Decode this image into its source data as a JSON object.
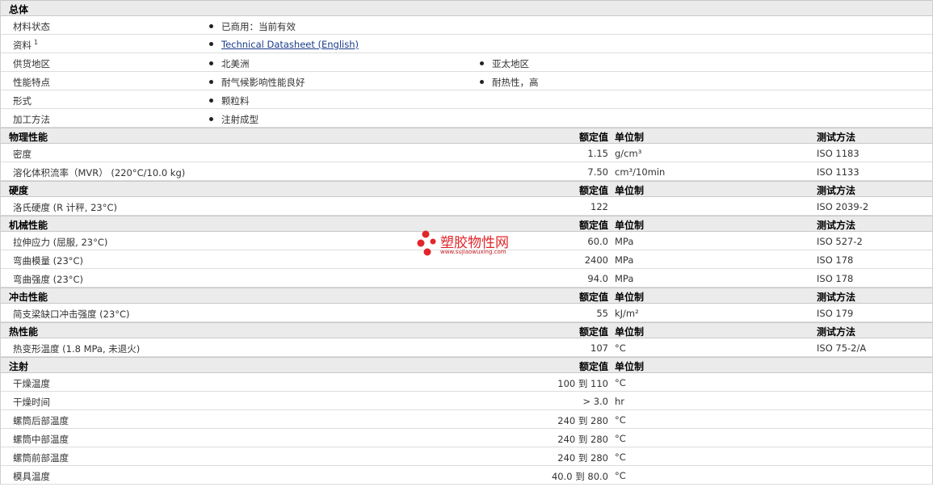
{
  "general": {
    "title": "总体",
    "rows": [
      {
        "label": "材料状态",
        "b1": "已商用：当前有效"
      },
      {
        "label": "资料",
        "sup": "1",
        "b1": "Technical Datasheet (English)"
      },
      {
        "label": "供货地区",
        "b1": "北美洲",
        "b2": "亚太地区"
      },
      {
        "label": "性能特点",
        "b1": "耐气候影响性能良好",
        "b2": "耐热性，高"
      },
      {
        "label": "形式",
        "b1": "颗粒料"
      },
      {
        "label": "加工方法",
        "b1": "注射成型"
      }
    ]
  },
  "headers": {
    "value": "额定值",
    "unit": "单位制",
    "method": "测试方法"
  },
  "physical": {
    "title": "物理性能",
    "rows": [
      {
        "label": "密度",
        "value": "1.15",
        "unit": "g/cm³",
        "method": "ISO 1183"
      },
      {
        "label": "溶化体积流率（MVR） (220°C/10.0 kg)",
        "value": "7.50",
        "unit": "cm³/10min",
        "method": "ISO 1133"
      }
    ]
  },
  "hardness": {
    "title": "硬度",
    "rows": [
      {
        "label": "洛氏硬度 (R 计秤, 23°C)",
        "value": "122",
        "unit": "",
        "method": "ISO 2039-2"
      }
    ]
  },
  "mechanical": {
    "title": "机械性能",
    "rows": [
      {
        "label": "拉伸应力 (屈服, 23°C)",
        "value": "60.0",
        "unit": "MPa",
        "method": "ISO 527-2"
      },
      {
        "label": "弯曲模量 (23°C)",
        "value": "2400",
        "unit": "MPa",
        "method": "ISO 178"
      },
      {
        "label": "弯曲强度 (23°C)",
        "value": "94.0",
        "unit": "MPa",
        "method": "ISO 178"
      }
    ]
  },
  "impact": {
    "title": "冲击性能",
    "rows": [
      {
        "label": "简支梁缺口冲击强度 (23°C)",
        "value": "55",
        "unit": "kJ/m²",
        "method": "ISO 179"
      }
    ]
  },
  "thermal": {
    "title": "热性能",
    "rows": [
      {
        "label": "热变形温度 (1.8 MPa, 未退火)",
        "value": "107",
        "unit": "°C",
        "method": "ISO 75-2/A"
      }
    ]
  },
  "injection": {
    "title": "注射",
    "rows": [
      {
        "label": "干燥温度",
        "value": "100 到  110",
        "unit": "°C"
      },
      {
        "label": "干燥时间",
        "value": "> 3.0",
        "unit": "hr"
      },
      {
        "label": "螺筒后部温度",
        "value": "240 到  280",
        "unit": "°C"
      },
      {
        "label": "螺筒中部温度",
        "value": "240 到  280",
        "unit": "°C"
      },
      {
        "label": "螺筒前部温度",
        "value": "240 到  280",
        "unit": "°C"
      },
      {
        "label": "模具温度",
        "value": "40.0 到  80.0",
        "unit": "°C"
      }
    ]
  },
  "watermark": {
    "name": "塑胶物性网",
    "url": "www.sujiaowuxing.com",
    "color": "#e0262b"
  }
}
